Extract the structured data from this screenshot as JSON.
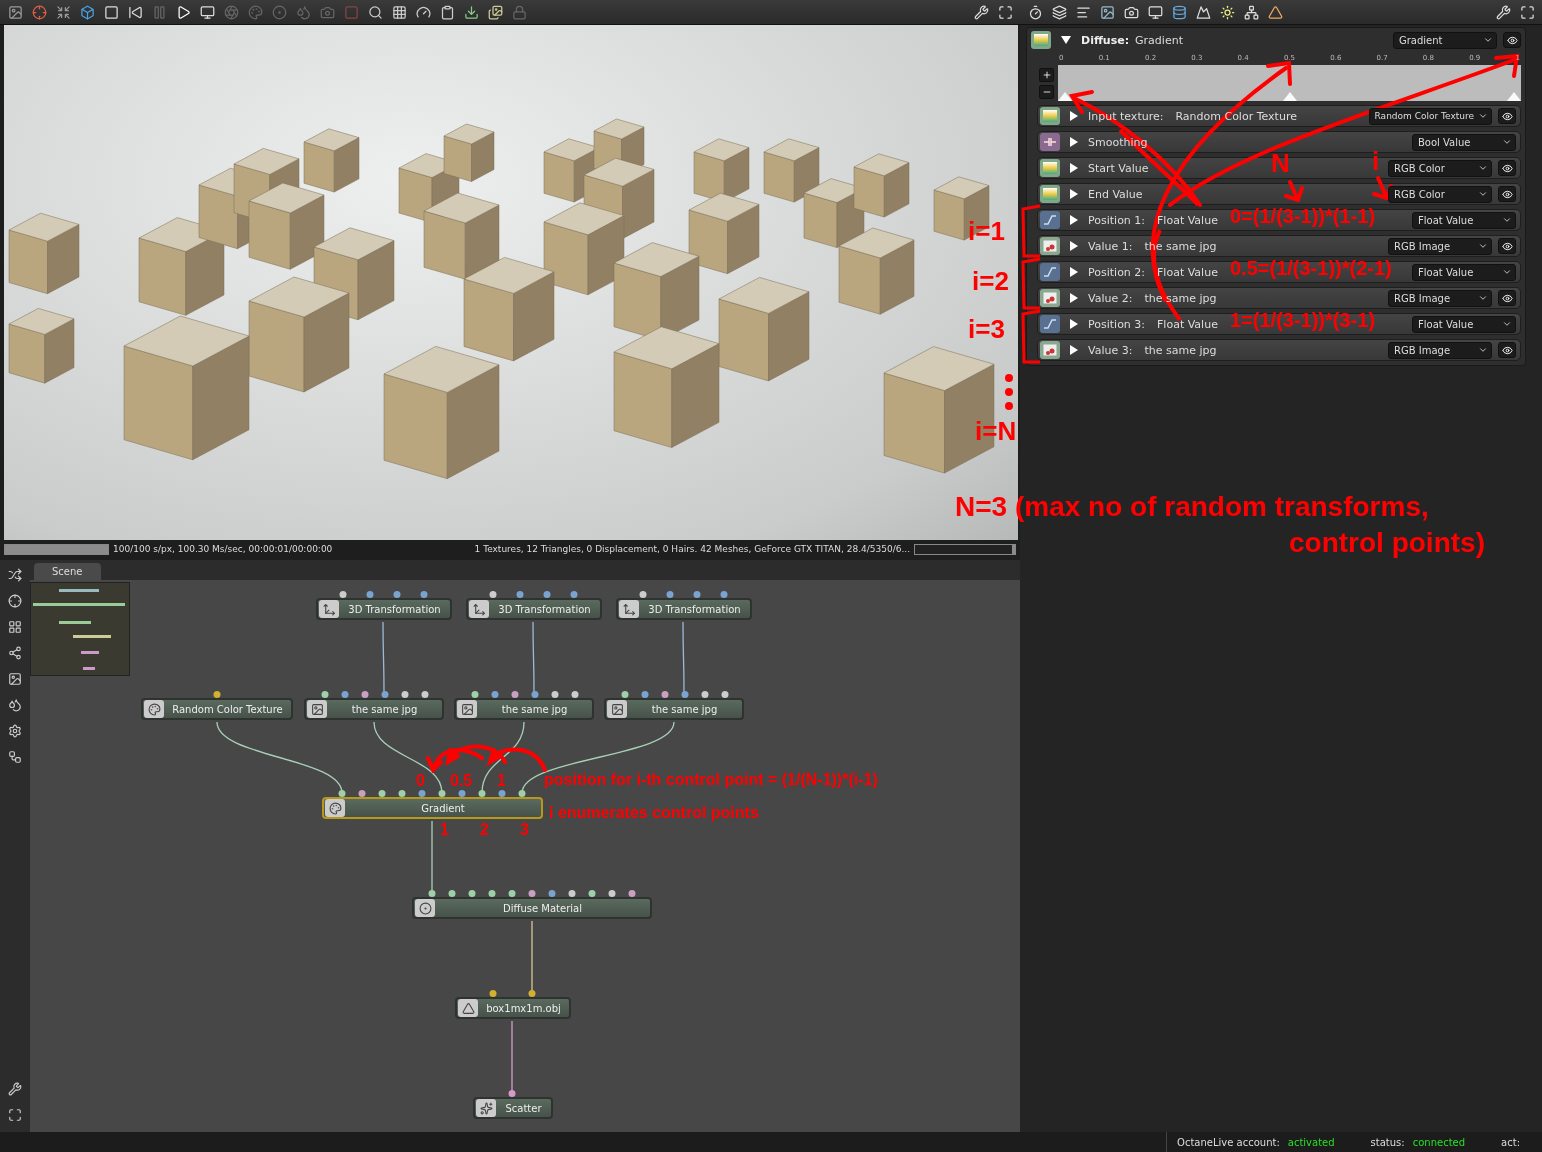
{
  "render_status": {
    "progress": {
      "level": 1
    },
    "info": "100/100 s/px, 100.30 Ms/sec, 00:00:01/00:00:00",
    "scene_info": "1 Textures, 12 Triangles, 0 Displacement, 0 Hairs. 42 Meshes, GeForce GTX TITAN, 28.4/5350/6...",
    "memory": {
      "level": 0.03
    }
  },
  "node_editor": {
    "tabs": [
      {
        "label": "Scene",
        "selected": true
      }
    ],
    "nodes": [
      {
        "kind": "transform",
        "label": "3D Transformation",
        "selected": false
      },
      {
        "kind": "transform",
        "label": "3D Transformation",
        "selected": false
      },
      {
        "kind": "transform",
        "label": "3D Transformation",
        "selected": false
      },
      {
        "kind": "texture",
        "label": "Random Color Texture",
        "selected": false
      },
      {
        "kind": "image",
        "label": "the same jpg",
        "selected": false
      },
      {
        "kind": "image",
        "label": "the same jpg",
        "selected": false
      },
      {
        "kind": "image",
        "label": "the same jpg",
        "selected": false
      },
      {
        "kind": "gradient",
        "label": "Gradient",
        "selected": true
      },
      {
        "kind": "material",
        "label": "Diffuse Material",
        "selected": false
      },
      {
        "kind": "mesh",
        "label": "box1mx1m.obj",
        "selected": false
      },
      {
        "kind": "scatter",
        "label": "Scatter",
        "selected": false
      }
    ]
  },
  "inspector": {
    "header": {
      "label": "Diffuse:",
      "value": "Gradient",
      "type": "Gradient",
      "expanded": true
    },
    "ticks": [
      "0",
      "0.1",
      "0.2",
      "0.3",
      "0.4",
      "0.5",
      "0.6",
      "0.7",
      "0.8",
      "0.9",
      "1"
    ],
    "markers": [
      {
        "level": 0
      },
      {
        "level": 0.5
      },
      {
        "level": 1
      }
    ],
    "rows": [
      {
        "kind": "texture",
        "label": "Input texture:",
        "value": "Random Color Texture",
        "type": "Random Color Texture",
        "expanded": false,
        "eye": true
      },
      {
        "kind": "bool",
        "label": "Smoothing",
        "type": "Bool Value",
        "expanded": false,
        "eye": false
      },
      {
        "kind": "texture",
        "label": "Start Value",
        "type": "RGB Color",
        "expanded": false,
        "eye": true
      },
      {
        "kind": "texture",
        "label": "End Value",
        "type": "RGB Color",
        "expanded": false,
        "eye": true
      },
      {
        "kind": "float",
        "label": "Position 1:",
        "value": "Float Value",
        "type": "Float Value",
        "expanded": false,
        "eye": false
      },
      {
        "kind": "image",
        "label": "Value 1:",
        "value": "the same jpg",
        "type": "RGB Image",
        "expanded": false,
        "eye": true
      },
      {
        "kind": "float",
        "label": "Position 2:",
        "value": "Float Value",
        "type": "Float Value",
        "expanded": false,
        "eye": false
      },
      {
        "kind": "image",
        "label": "Value 2:",
        "value": "the same jpg",
        "type": "RGB Image",
        "expanded": false,
        "eye": true
      },
      {
        "kind": "float",
        "label": "Position 3:",
        "value": "Float Value",
        "type": "Float Value",
        "expanded": false,
        "eye": false
      },
      {
        "kind": "image",
        "label": "Value 3:",
        "value": "the same jpg",
        "type": "RGB Image",
        "expanded": false,
        "eye": true
      }
    ]
  },
  "status_bar": {
    "account_label": "OctaneLive account:",
    "account": "activated",
    "status_label": "status:",
    "status": "connected",
    "act_label": "act:"
  },
  "annotations": [
    {
      "text": "N"
    },
    {
      "text": "i"
    },
    {
      "text": "i=1"
    },
    {
      "text": "0=(1/(3-1))*(1-1)"
    },
    {
      "text": "i=2"
    },
    {
      "text": "0.5=(1/(3-1))*(2-1)"
    },
    {
      "text": "i=3"
    },
    {
      "text": "1=(1/(3-1))*(3-1)"
    },
    {
      "text": "i=N"
    },
    {
      "text": "N=3 (max no of random transforms,"
    },
    {
      "text": "control points)"
    },
    {
      "text": "0"
    },
    {
      "text": "0.5"
    },
    {
      "text": "1"
    },
    {
      "text": "position for i-th control point = (1/(N-1))*(i-1)"
    },
    {
      "text": "i enumerates control points"
    },
    {
      "text": "1"
    },
    {
      "text": "2"
    },
    {
      "text": "3"
    }
  ]
}
